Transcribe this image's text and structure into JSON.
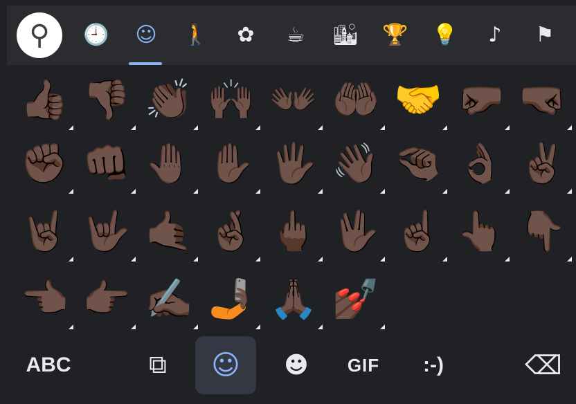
{
  "categories": [
    {
      "name": "search",
      "icon": "search-icon",
      "glyph": "⚲"
    },
    {
      "name": "recent",
      "icon": "clock-icon",
      "glyph": "🕘"
    },
    {
      "name": "smileys",
      "icon": "smiley-icon",
      "glyph": "☺"
    },
    {
      "name": "people",
      "icon": "person-icon",
      "glyph": "🚶"
    },
    {
      "name": "animals-nature",
      "icon": "flower-icon",
      "glyph": "✿"
    },
    {
      "name": "food-drink",
      "icon": "coffee-cup-icon",
      "glyph": "☕"
    },
    {
      "name": "travel-places",
      "icon": "buildings-car-icon",
      "glyph": "🏙"
    },
    {
      "name": "activities",
      "icon": "trophy-icon",
      "glyph": "🏆"
    },
    {
      "name": "objects",
      "icon": "lightbulb-icon",
      "glyph": "💡"
    },
    {
      "name": "symbols",
      "icon": "symbols-icon",
      "glyph": "♪"
    },
    {
      "name": "flags",
      "icon": "flag-icon",
      "glyph": "⚑"
    }
  ],
  "emojis": [
    {
      "name": "thumbs-up",
      "glyph": "👍🏿",
      "variants": true
    },
    {
      "name": "thumbs-down",
      "glyph": "👎🏿",
      "variants": true
    },
    {
      "name": "clapping-hands",
      "glyph": "👏🏿",
      "variants": true
    },
    {
      "name": "raising-hands",
      "glyph": "🙌🏿",
      "variants": true
    },
    {
      "name": "open-hands",
      "glyph": "👐🏿",
      "variants": true
    },
    {
      "name": "palms-up-together",
      "glyph": "🤲🏿",
      "variants": true
    },
    {
      "name": "handshake",
      "glyph": "🤝",
      "variants": true
    },
    {
      "name": "left-facing-fist",
      "glyph": "🤛🏿",
      "variants": true
    },
    {
      "name": "right-facing-fist",
      "glyph": "🤜🏿",
      "variants": true
    },
    {
      "name": "raised-fist",
      "glyph": "✊🏿",
      "variants": true
    },
    {
      "name": "oncoming-fist",
      "glyph": "👊🏿",
      "variants": true
    },
    {
      "name": "raised-back-of-hand",
      "glyph": "🤚🏿",
      "variants": true
    },
    {
      "name": "raised-hand",
      "glyph": "✋🏿",
      "variants": true
    },
    {
      "name": "hand-with-fingers-splayed",
      "glyph": "🖐🏿",
      "variants": true
    },
    {
      "name": "waving-hand",
      "glyph": "👋🏿",
      "variants": true
    },
    {
      "name": "pinching-hand",
      "glyph": "🤏🏿",
      "variants": true
    },
    {
      "name": "ok-hand",
      "glyph": "👌🏿",
      "variants": true
    },
    {
      "name": "victory-hand",
      "glyph": "✌🏿",
      "variants": true
    },
    {
      "name": "sign-of-the-horns",
      "glyph": "🤘🏿",
      "variants": true
    },
    {
      "name": "love-you-gesture",
      "glyph": "🤟🏿",
      "variants": true
    },
    {
      "name": "call-me-hand",
      "glyph": "🤙🏿",
      "variants": true
    },
    {
      "name": "crossed-fingers",
      "glyph": "🤞🏿",
      "variants": true
    },
    {
      "name": "middle-finger",
      "glyph": "🖕🏿",
      "variants": true
    },
    {
      "name": "vulcan-salute",
      "glyph": "🖖🏿",
      "variants": true
    },
    {
      "name": "index-pointing-up",
      "glyph": "☝🏿",
      "variants": true
    },
    {
      "name": "backhand-index-pointing-up",
      "glyph": "👆🏿",
      "variants": true
    },
    {
      "name": "backhand-index-pointing-down",
      "glyph": "👇🏿",
      "variants": true
    },
    {
      "name": "backhand-index-pointing-left",
      "glyph": "👈🏿",
      "variants": true
    },
    {
      "name": "backhand-index-pointing-right",
      "glyph": "👉🏿",
      "variants": true
    },
    {
      "name": "writing-hand",
      "glyph": "✍🏿",
      "variants": true
    },
    {
      "name": "selfie",
      "glyph": "🤳🏿",
      "variants": true
    },
    {
      "name": "folded-hands",
      "glyph": "🙏🏿",
      "variants": true
    },
    {
      "name": "nail-polish",
      "glyph": "💅🏿",
      "variants": true
    }
  ],
  "toolbar": {
    "abc_label": "ABC",
    "gif_label": "GIF",
    "emoticon_label": ":-)",
    "sticker_search_glyph": "⧉",
    "emoji_glyph": "☺",
    "sticker_glyph": "☻",
    "backspace_glyph": "⌫"
  },
  "colors": {
    "background": "#202124",
    "category_bar": "#2b2c30",
    "accent": "#8ab4f8",
    "icon": "#e8eaed"
  }
}
